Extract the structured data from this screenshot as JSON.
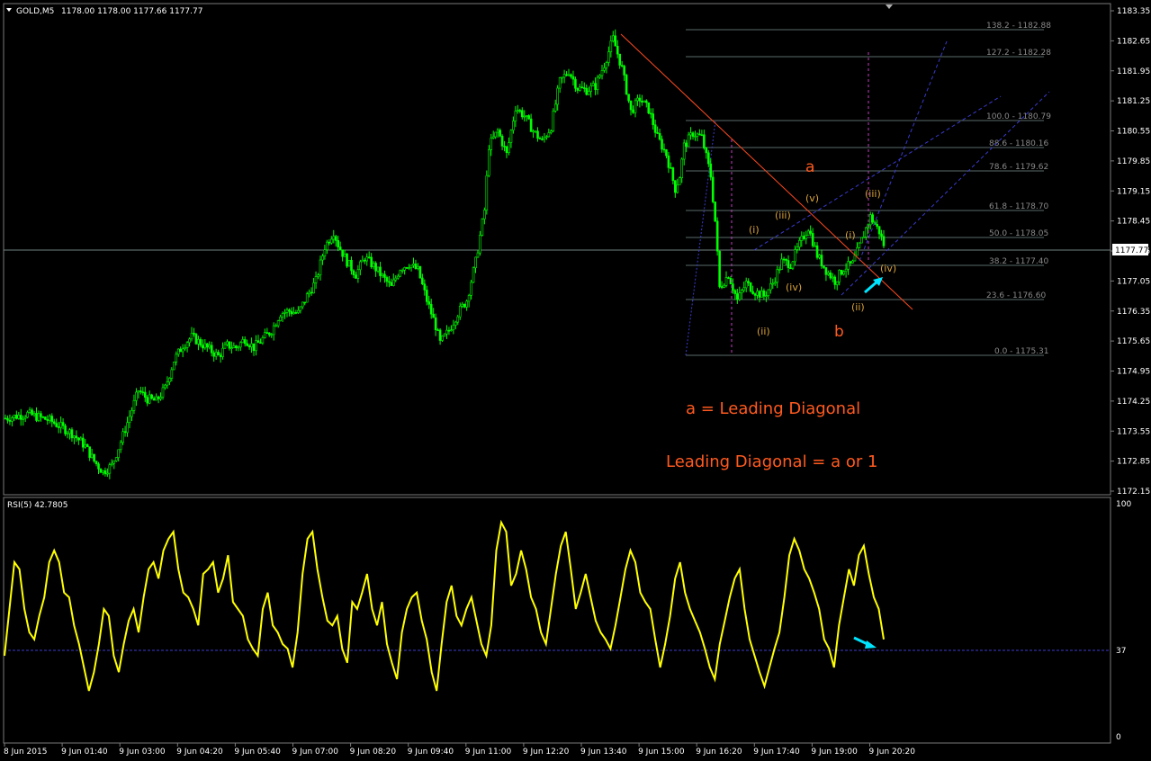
{
  "header": {
    "symbol": "GOLD,M5",
    "ohlc": "1178.00 1178.00 1177.66 1177.77"
  },
  "rsi_header": "RSI(5) 42.7805",
  "current_price_label": "1177.77",
  "annotations": {
    "note1": "a = Leading Diagonal",
    "note2": "Leading Diagonal = a or 1",
    "wave_a": "a",
    "wave_b": "b",
    "sub_i_1": "(i)",
    "sub_ii_1": "(ii)",
    "sub_iii_1": "(iii)",
    "sub_iv_1": "(iv)",
    "sub_v_1": "(v)",
    "sub_i_2": "(i)",
    "sub_ii_2": "(ii)",
    "sub_iii_2": "(iii)",
    "sub_iv_2": "(iv)"
  },
  "colors": {
    "background": "#000000",
    "candle": "#00ff00",
    "rsi": "#ffff00",
    "trendline": "#ff4a1f",
    "fib": "#6f7f7f",
    "channel": "#3a3ad0",
    "cyan_arrow": "#00e5ff",
    "wave_label": "#d9a33a"
  },
  "chart_data": [
    {
      "type": "candlestick",
      "title": "GOLD,M5",
      "ylim": [
        1172.15,
        1183.35
      ],
      "y_ticks": [
        "1183.35",
        "1182.65",
        "1181.95",
        "1181.25",
        "1180.55",
        "1179.85",
        "1179.15",
        "1178.45",
        "1177.75",
        "1177.05",
        "1176.35",
        "1175.65",
        "1174.95",
        "1174.25",
        "1173.55",
        "1172.85",
        "1172.15"
      ],
      "x_ticks": [
        "8 Jun 2015",
        "9 Jun 01:40",
        "9 Jun 03:00",
        "9 Jun 04:20",
        "9 Jun 05:40",
        "9 Jun 07:00",
        "9 Jun 08:20",
        "9 Jun 09:40",
        "9 Jun 11:00",
        "9 Jun 12:20",
        "9 Jun 13:40",
        "9 Jun 15:00",
        "9 Jun 16:20",
        "9 Jun 17:40",
        "9 Jun 19:00",
        "9 Jun 20:20"
      ],
      "current_price": 1177.77,
      "close_path": [
        [
          0,
          1173.85
        ],
        [
          5,
          1173.95
        ],
        [
          10,
          1173.8
        ],
        [
          15,
          1173.5
        ],
        [
          18,
          1173.2
        ],
        [
          20,
          1172.85
        ],
        [
          22,
          1172.6
        ],
        [
          24,
          1172.75
        ],
        [
          26,
          1173.3
        ],
        [
          28,
          1173.9
        ],
        [
          30,
          1174.5
        ],
        [
          32,
          1174.3
        ],
        [
          34,
          1174.25
        ],
        [
          36,
          1174.55
        ],
        [
          38,
          1175.2
        ],
        [
          40,
          1175.55
        ],
        [
          42,
          1175.75
        ],
        [
          44,
          1175.6
        ],
        [
          46,
          1175.45
        ],
        [
          48,
          1175.3
        ],
        [
          50,
          1175.55
        ],
        [
          52,
          1175.5
        ],
        [
          54,
          1175.7
        ],
        [
          56,
          1175.5
        ],
        [
          58,
          1175.7
        ],
        [
          60,
          1175.9
        ],
        [
          62,
          1176.3
        ],
        [
          64,
          1176.35
        ],
        [
          66,
          1176.3
        ],
        [
          68,
          1176.7
        ],
        [
          70,
          1177.05
        ],
        [
          72,
          1177.85
        ],
        [
          74,
          1178.2
        ],
        [
          75,
          1177.9
        ],
        [
          77,
          1177.5
        ],
        [
          79,
          1177.2
        ],
        [
          81,
          1177.6
        ],
        [
          83,
          1177.4
        ],
        [
          85,
          1177.15
        ],
        [
          87,
          1176.9
        ],
        [
          89,
          1177.35
        ],
        [
          91,
          1177.45
        ],
        [
          93,
          1177.3
        ],
        [
          95,
          1176.6
        ],
        [
          97,
          1176.0
        ],
        [
          98,
          1175.6
        ],
        [
          100,
          1175.9
        ],
        [
          102,
          1176.3
        ],
        [
          104,
          1176.6
        ],
        [
          106,
          1177.5
        ],
        [
          108,
          1178.7
        ],
        [
          109,
          1180.2
        ],
        [
          111,
          1180.55
        ],
        [
          113,
          1180.0
        ],
        [
          115,
          1181.1
        ],
        [
          117,
          1180.9
        ],
        [
          119,
          1180.55
        ],
        [
          121,
          1180.3
        ],
        [
          123,
          1180.65
        ],
        [
          125,
          1181.7
        ],
        [
          127,
          1181.95
        ],
        [
          129,
          1181.55
        ],
        [
          131,
          1181.5
        ],
        [
          133,
          1181.6
        ],
        [
          135,
          1182.1
        ],
        [
          137,
          1182.7
        ],
        [
          139,
          1182.0
        ],
        [
          141,
          1181.0
        ],
        [
          143,
          1181.3
        ],
        [
          145,
          1181.05
        ],
        [
          147,
          1180.4
        ],
        [
          149,
          1180.0
        ],
        [
          151,
          1179.2
        ],
        [
          152,
          1179.5
        ],
        [
          153,
          1180.2
        ],
        [
          155,
          1180.5
        ],
        [
          157,
          1180.4
        ],
        [
          159,
          1179.5
        ],
        [
          160,
          1178.45
        ],
        [
          161,
          1176.9
        ],
        [
          163,
          1177.2
        ],
        [
          165,
          1176.6
        ],
        [
          167,
          1177.0
        ],
        [
          169,
          1176.8
        ],
        [
          171,
          1176.7
        ],
        [
          173,
          1177.0
        ],
        [
          175,
          1177.5
        ],
        [
          177,
          1177.45
        ],
        [
          179,
          1177.9
        ],
        [
          181,
          1178.3
        ],
        [
          183,
          1177.65
        ],
        [
          185,
          1177.3
        ],
        [
          187,
          1177.05
        ],
        [
          189,
          1177.35
        ],
        [
          191,
          1177.45
        ],
        [
          193,
          1178.0
        ],
        [
          195,
          1178.55
        ],
        [
          197,
          1178.2
        ],
        [
          198,
          1177.9
        ]
      ]
    },
    {
      "type": "line",
      "title": "RSI(5) 42.7805",
      "ylim": [
        0,
        100
      ],
      "y_ticks": [
        "100",
        "37",
        "0"
      ],
      "reference_level": 37,
      "last_value": 42.7805,
      "values": [
        35,
        55,
        75,
        72,
        55,
        45,
        42,
        52,
        60,
        75,
        80,
        75,
        62,
        60,
        48,
        40,
        30,
        20,
        28,
        40,
        55,
        52,
        35,
        28,
        40,
        50,
        55,
        45,
        60,
        72,
        75,
        68,
        80,
        85,
        88,
        72,
        62,
        60,
        55,
        48,
        70,
        72,
        75,
        62,
        68,
        78,
        58,
        55,
        52,
        42,
        38,
        35,
        55,
        62,
        48,
        45,
        40,
        38,
        30,
        45,
        70,
        85,
        88,
        72,
        60,
        50,
        48,
        52,
        38,
        32,
        58,
        55,
        62,
        70,
        55,
        48,
        58,
        40,
        32,
        25,
        45,
        55,
        60,
        62,
        50,
        42,
        28,
        20,
        40,
        58,
        65,
        52,
        48,
        55,
        60,
        50,
        40,
        35,
        48,
        80,
        92,
        88,
        65,
        70,
        80,
        72,
        60,
        55,
        45,
        40,
        55,
        70,
        82,
        88,
        72,
        55,
        62,
        70,
        60,
        50,
        45,
        42,
        38,
        48,
        60,
        72,
        80,
        75,
        62,
        58,
        55,
        42,
        30,
        40,
        52,
        68,
        75,
        62,
        55,
        50,
        45,
        38,
        30,
        25,
        40,
        50,
        60,
        68,
        72,
        55,
        42,
        35,
        28,
        22,
        30,
        38,
        45,
        60,
        78,
        85,
        80,
        72,
        68,
        62,
        55,
        42,
        38,
        30,
        48,
        60,
        72,
        65,
        78,
        82,
        70,
        60,
        55,
        42
      ]
    }
  ]
}
